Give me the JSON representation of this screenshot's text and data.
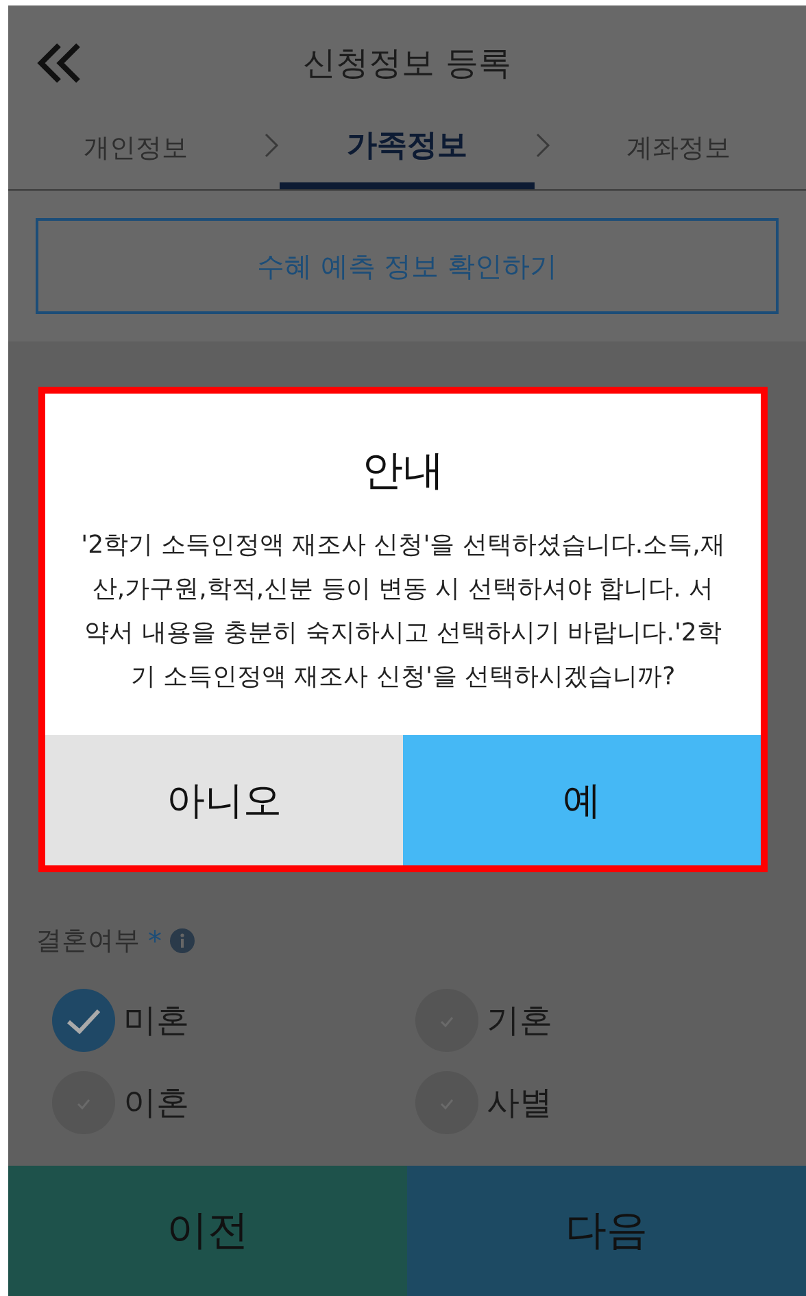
{
  "header": {
    "title": "신청정보 등록"
  },
  "steps": [
    {
      "label": "개인정보",
      "selected": false
    },
    {
      "label": "가족정보",
      "selected": true
    },
    {
      "label": "계좌정보",
      "selected": false
    }
  ],
  "benefit_button": "수혜 예측 정보 확인하기",
  "marriage": {
    "label": "결혼여부",
    "required_mark": "*",
    "options": [
      {
        "label": "미혼",
        "selected": true
      },
      {
        "label": "기혼",
        "selected": false
      },
      {
        "label": "이혼",
        "selected": false
      },
      {
        "label": "사별",
        "selected": false
      }
    ]
  },
  "bottom_buttons": [
    "이전",
    "다음"
  ],
  "dialog": {
    "title": "안내",
    "message": "'2학기 소득인정액 재조사 신청'을 선택하셨습니다.소득,재산,가구원,학적,신분 등이 변동 시 선택하셔야 합니다. 서약서 내용을 충분히 숙지하시고 선택하시기 바랍니다.'2학기 소득인정액 재조사 신청'을 선택하시겠습니까?",
    "buttons": [
      "아니오",
      "예"
    ]
  }
}
